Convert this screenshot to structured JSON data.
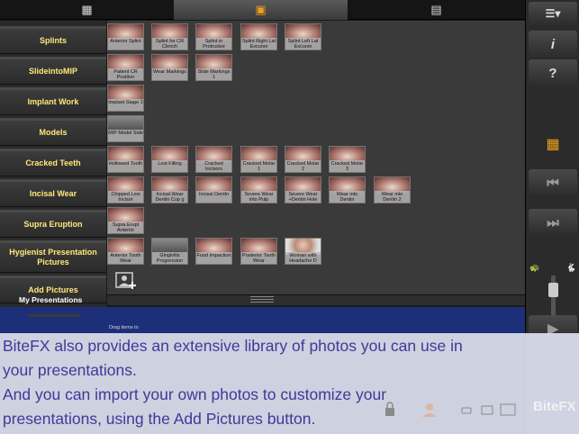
{
  "top_tabs": [
    {
      "icon": "film-icon",
      "glyph": "▦"
    },
    {
      "icon": "portrait-icon",
      "glyph": "▣"
    },
    {
      "icon": "presentation-icon",
      "glyph": "▤"
    }
  ],
  "categories": [
    "Splints",
    "SlideintoMIP",
    "Implant Work",
    "Models",
    "Cracked Teeth",
    "Incisal Wear",
    "Supra Eruption",
    "Hygienist Presentation Pictures",
    "Add Pictures"
  ],
  "thumb_rows": [
    [
      "Anterior Splint",
      "Splint for CR Clench",
      "Splint in Protrusive",
      "Splint Right Lat Excursn",
      "Splint Left Lat Excursn"
    ],
    [
      "Patient CR Position",
      "Wear Markings",
      "Slide Markings 1"
    ],
    [
      "Implant Stage 1"
    ],
    [
      "MIP Model Side"
    ],
    [
      "Hollowed Tooth",
      "Lost Filling",
      "Cracked Incisors",
      "Cracked Molar 1",
      "Cracked Molar 2",
      "Cracked Molar 3"
    ],
    [
      "Chipped Low Incisor",
      "Incisal Wear Dentin Cup g",
      "Incisal Dentin",
      "Severe Wear into Pulp",
      "Severe Wear +Dentin Hole",
      "Wear into Dentin",
      "Wear into Dentin 2"
    ],
    [
      "Supra Erupt Anterior"
    ],
    [
      "Anterior Tooth Wear",
      "Gingivitis Progression",
      "Food Impaction",
      "Posterior Tooth Wear",
      "Woman with Headache D"
    ]
  ],
  "my_presentations": "My Presentations",
  "drag_label": "Drag items to",
  "right_buttons": {
    "list": "☰▾",
    "info": "i",
    "help": "?",
    "film": "▦",
    "prev": "⏮",
    "next": "⏭",
    "slow": "🐢",
    "fast": "🐇",
    "play": "▶"
  },
  "overlay_lines": [
    "BiteFX also provides an extensive library of photos you can use in",
    "your presentations.",
    "And you can import your own photos to customize your",
    "presentations, using the Add Pictures button."
  ],
  "brand": "BiteFX",
  "colors": {
    "category_text": "#ffe97a",
    "overlay_text": "#3c3a9a",
    "active_accent": "#f0a020",
    "presentation_pane": "#1c2f78"
  }
}
